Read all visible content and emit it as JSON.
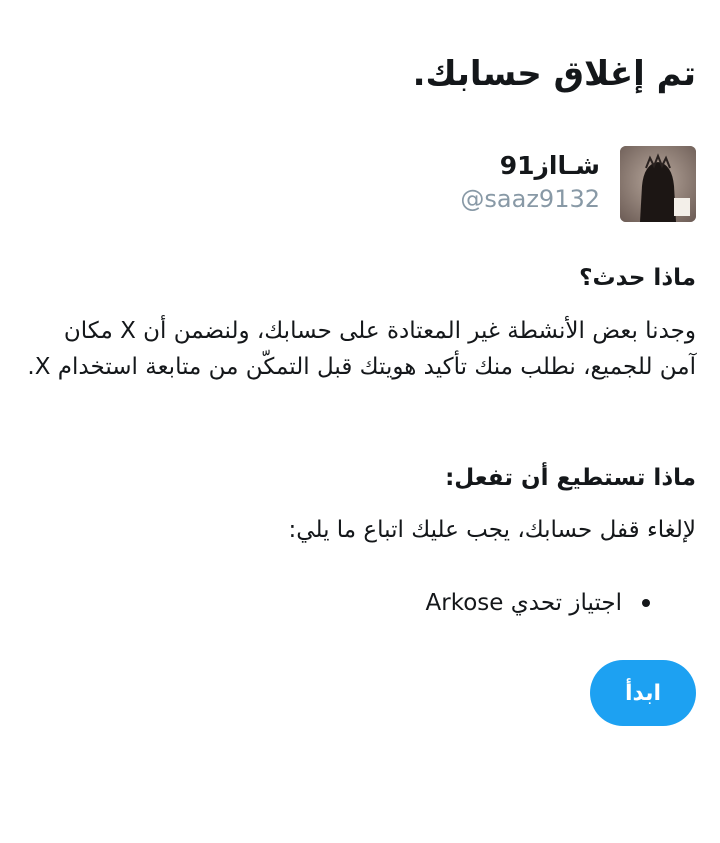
{
  "page": {
    "title": "تم إغلاق حسابك."
  },
  "user": {
    "display_name": "شـااز91",
    "handle": "@saaz9132"
  },
  "what_happened": {
    "heading": "ماذا حدث؟",
    "body": "وجدنا بعض الأنشطة غير المعتادة على حسابك، ولنضمن أن X مكان آمن للجميع، نطلب منك تأكيد هويتك قبل التمكّن من متابعة استخدام X."
  },
  "what_to_do": {
    "heading": "ماذا تستطيع أن تفعل:",
    "body": "لإلغاء قفل حسابك، يجب عليك اتباع ما يلي:",
    "requirements": [
      "اجتياز تحدي Arkose"
    ]
  },
  "actions": {
    "start_label": "ابدأ"
  },
  "colors": {
    "accent": "#1da1f2",
    "secondary_text": "#8899a6",
    "primary_text": "#14171a"
  }
}
